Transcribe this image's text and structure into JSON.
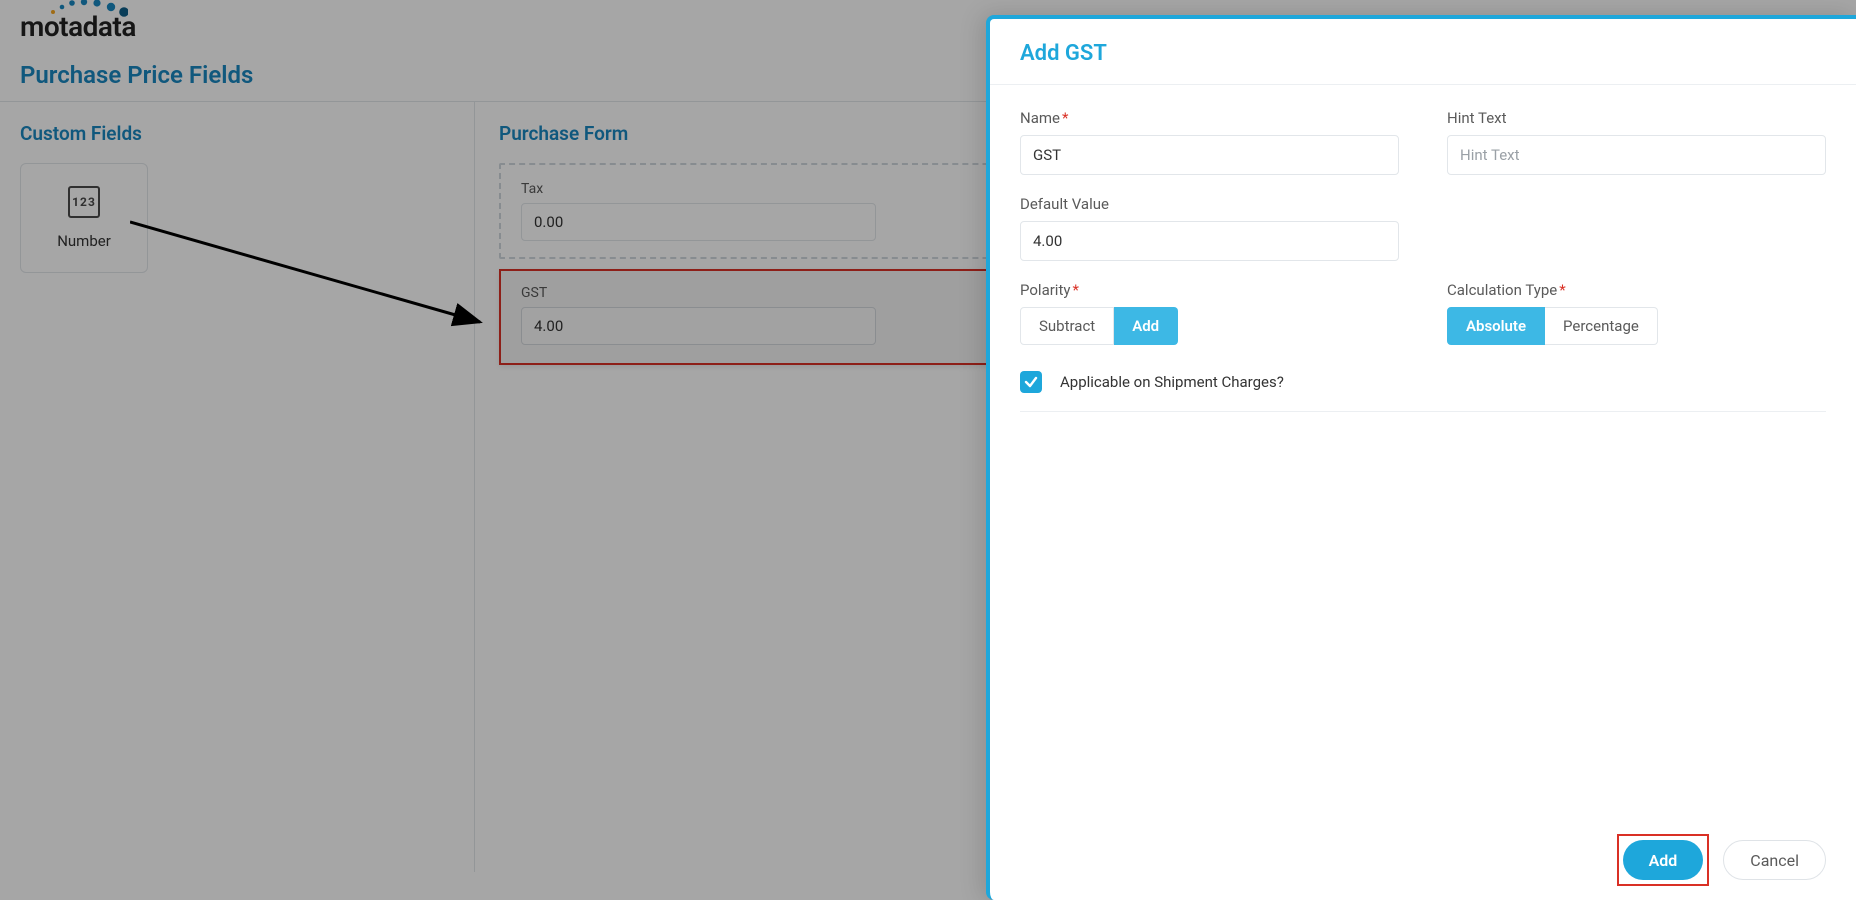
{
  "logo": "motadata",
  "page": {
    "title": "Purchase Price Fields",
    "left_section_title": "Custom Fields",
    "right_section_title": "Purchase Form",
    "number_tile": {
      "icon_text": "123",
      "label": "Number"
    },
    "form": {
      "tax": {
        "label": "Tax",
        "value": "0.00"
      },
      "gst": {
        "label": "GST",
        "value": "4.00"
      }
    }
  },
  "panel": {
    "title": "Add GST",
    "fields": {
      "name": {
        "label": "Name",
        "value": "GST"
      },
      "hint": {
        "label": "Hint Text",
        "placeholder": "Hint Text",
        "value": ""
      },
      "default_value": {
        "label": "Default Value",
        "value": "4.00"
      },
      "polarity": {
        "label": "Polarity",
        "options": [
          "Subtract",
          "Add"
        ],
        "selected": "Add"
      },
      "calc_type": {
        "label": "Calculation Type",
        "options": [
          "Absolute",
          "Percentage"
        ],
        "selected": "Absolute"
      },
      "applicable_shipment": {
        "label": "Applicable on Shipment Charges?",
        "checked": true
      }
    },
    "footer": {
      "add": "Add",
      "cancel": "Cancel"
    }
  }
}
